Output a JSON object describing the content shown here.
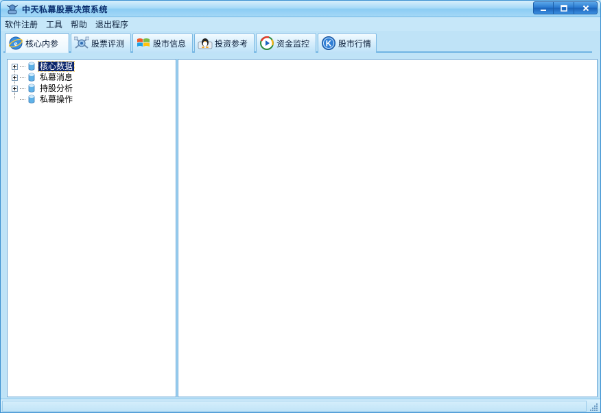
{
  "window": {
    "title": "中天私幕股票决策系统",
    "controls": {
      "minimize": "minimize-icon",
      "maximize": "maximize-icon",
      "close": "close-icon"
    }
  },
  "menu": {
    "items": [
      {
        "label": "软件注册"
      },
      {
        "label": "工具"
      },
      {
        "label": "帮助"
      },
      {
        "label": "退出程序"
      }
    ]
  },
  "tabs": [
    {
      "label": "核心内参",
      "icon": "ie-globe-icon",
      "active": true
    },
    {
      "label": "股票评测",
      "icon": "satellite-icon",
      "active": false
    },
    {
      "label": "股市信息",
      "icon": "windows-flag-icon",
      "active": false
    },
    {
      "label": "投资参考",
      "icon": "penguin-icon",
      "active": false
    },
    {
      "label": "资金监控",
      "icon": "media-play-icon",
      "active": false
    },
    {
      "label": "股市行情",
      "icon": "k-letter-icon",
      "active": false
    }
  ],
  "tree": {
    "nodes": [
      {
        "label": "核心数据",
        "expandable": true,
        "selected": true
      },
      {
        "label": "私幕消息",
        "expandable": true,
        "selected": false
      },
      {
        "label": "持股分析",
        "expandable": true,
        "selected": false
      },
      {
        "label": "私幕操作",
        "expandable": false,
        "selected": false
      }
    ]
  },
  "colors": {
    "titlebar": "#a9dbf8",
    "accent": "#3a8fd0",
    "selection": "#0a246a"
  }
}
